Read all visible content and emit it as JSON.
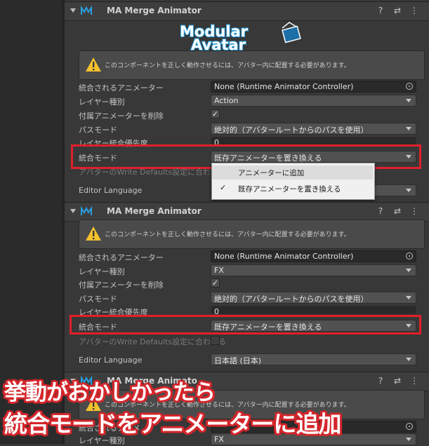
{
  "component": {
    "title": "MA Merge Animator",
    "header_icons": [
      "help-icon",
      "preset-icon",
      "more-icon"
    ]
  },
  "logo": {
    "line1": "Modular",
    "line2": "Avatar"
  },
  "warning": {
    "text": "このコンポーネントを正しく動作させるには、アバター内に配置する必要があります。"
  },
  "labels": {
    "animator": "統合されるアニメーター",
    "layer_type": "レイヤー種別",
    "delete_attached": "付属アニメーターを削除",
    "path_mode": "パスモード",
    "layer_priority": "レイヤー統合優先度",
    "merge_mode": "統合モード",
    "write_defaults": "アバターのWrite Defaults設定に合わせる",
    "editor_language": "Editor Language"
  },
  "panel1": {
    "animator_value": "None (Runtime Animator Controller)",
    "layer_type_value": "Action",
    "path_mode_value": "絶対的（アバタールートからのパスを使用）",
    "priority_value": "0",
    "merge_mode_value": "既存アニメーターを置き換える"
  },
  "dropdown": {
    "items": [
      "アニメーターに追加",
      "既存アニメーターを置き換える"
    ],
    "checked_index": 1,
    "check_mark": "✓"
  },
  "panel2": {
    "animator_value": "None (Runtime Animator Controller)",
    "layer_type_value": "FX",
    "path_mode_value": "絶対的（アバタールートからのパスを使用）",
    "priority_value": "0",
    "merge_mode_value": "既存アニメーターを置き換える",
    "language_value": "日本語 (日本)"
  },
  "panel3": {
    "header_partial": "MA Merge Animato",
    "animator_partial": "統合されるアニメ",
    "layer_type_value": "FX"
  },
  "caption": {
    "line1": "挙動がおかしかったら",
    "line2": "統合モードをアニメーターに追加"
  },
  "colors": {
    "highlight_red": "#e0202a",
    "caption_red": "#d4262b",
    "logo_blue": "#2a9fe0"
  }
}
